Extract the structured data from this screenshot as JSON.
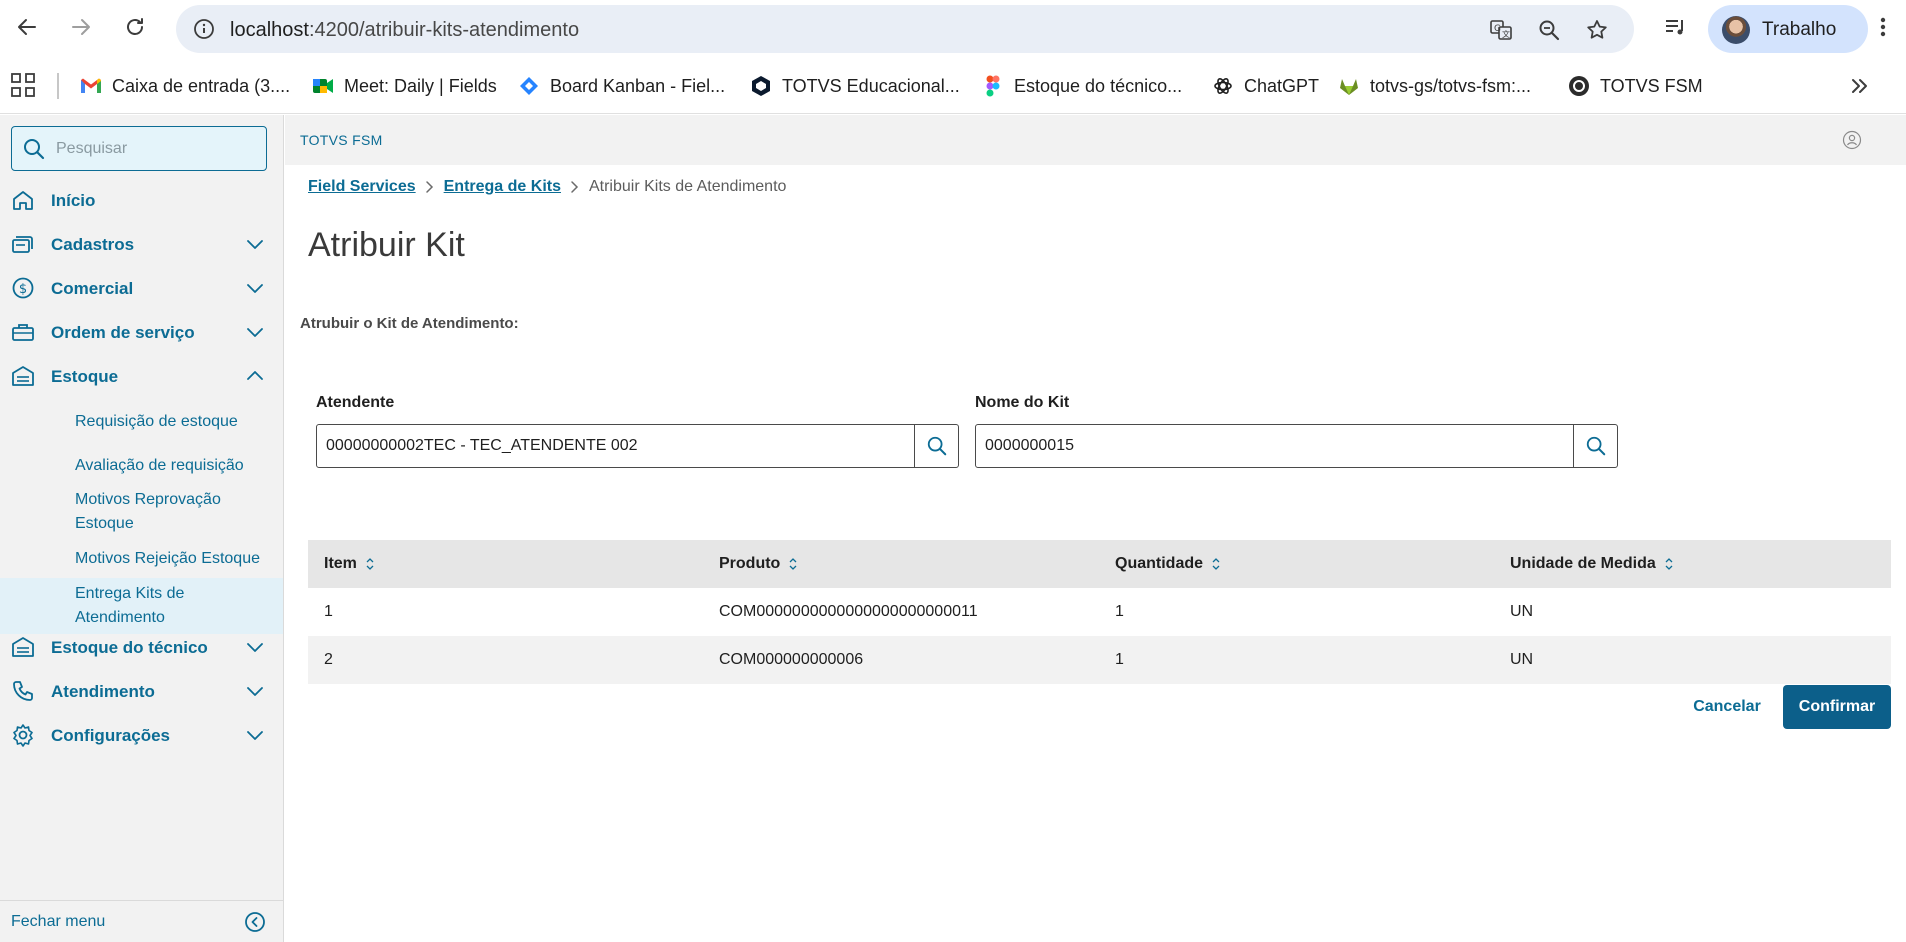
{
  "browser": {
    "url_host": "localhost",
    "url_path": ":4200/atribuir-kits-atendimento",
    "profile_name": "Trabalho",
    "bookmarks": [
      {
        "label": "Caixa de entrada (3....",
        "icon": "gmail-icon"
      },
      {
        "label": "Meet: Daily | Fields",
        "icon": "meet-icon"
      },
      {
        "label": "Board Kanban - Fiel...",
        "icon": "jira-icon"
      },
      {
        "label": "TOTVS Educacional...",
        "icon": "totvs-edu-icon"
      },
      {
        "label": "Estoque do técnico...",
        "icon": "figma-icon"
      },
      {
        "label": "ChatGPT",
        "icon": "chatgpt-icon"
      },
      {
        "label": "totvs-gs/totvs-fsm:...",
        "icon": "gitlab-icon"
      },
      {
        "label": "TOTVS FSM",
        "icon": "totvs-fsm-icon"
      }
    ]
  },
  "sidebar": {
    "search_placeholder": "Pesquisar",
    "items": [
      {
        "label": "Início",
        "icon": "home-icon"
      },
      {
        "label": "Cadastros",
        "icon": "cards-icon"
      },
      {
        "label": "Comercial",
        "icon": "dollar-icon"
      },
      {
        "label": "Ordem de serviço",
        "icon": "toolbox-icon"
      },
      {
        "label": "Estoque",
        "icon": "warehouse-icon"
      },
      {
        "label": "Estoque do técnico",
        "icon": "warehouse-icon"
      },
      {
        "label": "Atendimento",
        "icon": "phone-icon"
      },
      {
        "label": "Configurações",
        "icon": "gear-icon"
      }
    ],
    "estoque_subitems": [
      "Requisição de estoque",
      "Avaliação de requisição",
      "Motivos Reprovação Estoque",
      "Motivos Rejeição Estoque",
      "Entrega Kits de Atendimento"
    ],
    "close_menu": "Fechar menu"
  },
  "header": {
    "app_title": "TOTVS FSM"
  },
  "breadcrumb": {
    "items": [
      "Field Services",
      "Entrega de Kits",
      "Atribuir Kits de Atendimento"
    ]
  },
  "page": {
    "title": "Atribuir Kit",
    "section_label": "Atrubuir o Kit de Atendimento:"
  },
  "form": {
    "atendente_label": "Atendente",
    "atendente_value": "00000000002TEC - TEC_ATENDENTE 002",
    "kit_label": "Nome do Kit",
    "kit_value": "0000000015"
  },
  "table": {
    "columns": [
      "Item",
      "Produto",
      "Quantidade",
      "Unidade de Medida"
    ],
    "rows": [
      [
        "1",
        "COM0000000000000000000000011",
        "1",
        "UN"
      ],
      [
        "2",
        "COM000000000006",
        "1",
        "UN"
      ]
    ]
  },
  "actions": {
    "cancel": "Cancelar",
    "confirm": "Confirmar"
  },
  "colors": {
    "primary": "#0c6c94",
    "confirm_button": "#0c5f8a",
    "sidebar_bg": "#f2f2f2",
    "active_item_bg": "#e2f1f8"
  }
}
